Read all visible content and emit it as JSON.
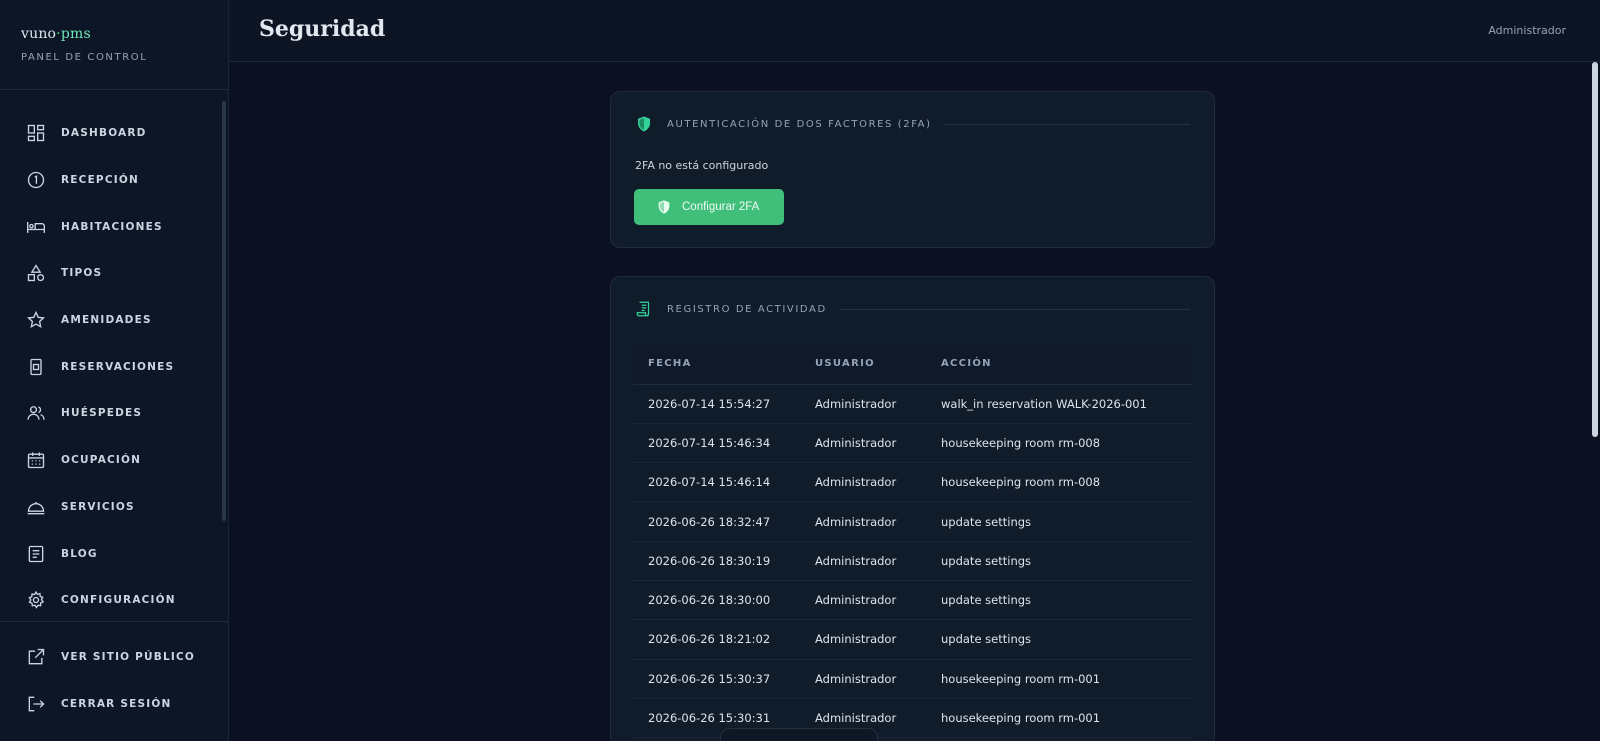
{
  "brand": {
    "logo_main": "vuno",
    "logo_dot": "·",
    "logo_pms": "pms",
    "subtitle": "PANEL DE CONTROL"
  },
  "sidebar": {
    "items": [
      {
        "label": "DASHBOARD",
        "icon": "dashboard-icon"
      },
      {
        "label": "RECEPCIÓN",
        "icon": "reception-icon"
      },
      {
        "label": "HABITACIONES",
        "icon": "bed-icon"
      },
      {
        "label": "TIPOS",
        "icon": "shapes-icon"
      },
      {
        "label": "AMENIDADES",
        "icon": "star-icon"
      },
      {
        "label": "RESERVACIONES",
        "icon": "reservation-icon"
      },
      {
        "label": "HUÉSPEDES",
        "icon": "users-icon"
      },
      {
        "label": "OCUPACIÓN",
        "icon": "calendar-icon"
      },
      {
        "label": "SERVICIOS",
        "icon": "service-bell-icon"
      },
      {
        "label": "BLOG",
        "icon": "blog-icon"
      },
      {
        "label": "CONFIGURACIÓN",
        "icon": "gear-icon"
      }
    ],
    "bottom_items": [
      {
        "label": "VER SITIO PÚBLICO",
        "icon": "external-link-icon"
      },
      {
        "label": "CERRAR SESIÓN",
        "icon": "logout-icon"
      }
    ]
  },
  "header": {
    "title": "Seguridad",
    "user": "Administrador"
  },
  "twofa": {
    "title": "AUTENTICACIÓN DE DOS FACTORES (2FA)",
    "status": "2FA no está configurado",
    "button_label": "Configurar 2FA"
  },
  "activity": {
    "title": "REGISTRO DE ACTIVIDAD",
    "columns": [
      "FECHA",
      "USUARIO",
      "ACCIÓN"
    ],
    "rows": [
      [
        "2026-07-14 15:54:27",
        "Administrador",
        "walk_in reservation WALK-2026-001"
      ],
      [
        "2026-07-14 15:46:34",
        "Administrador",
        "housekeeping room rm-008"
      ],
      [
        "2026-07-14 15:46:14",
        "Administrador",
        "housekeeping room rm-008"
      ],
      [
        "2026-06-26 18:32:47",
        "Administrador",
        "update settings"
      ],
      [
        "2026-06-26 18:30:19",
        "Administrador",
        "update settings"
      ],
      [
        "2026-06-26 18:30:00",
        "Administrador",
        "update settings"
      ],
      [
        "2026-06-26 18:21:02",
        "Administrador",
        "update settings"
      ],
      [
        "2026-06-26 15:30:37",
        "Administrador",
        "housekeeping room rm-001"
      ],
      [
        "2026-06-26 15:30:31",
        "Administrador",
        "housekeeping room rm-001"
      ]
    ]
  },
  "colors": {
    "accent": "#3fbf7a",
    "background": "#0b1120",
    "card": "#111c2b"
  }
}
